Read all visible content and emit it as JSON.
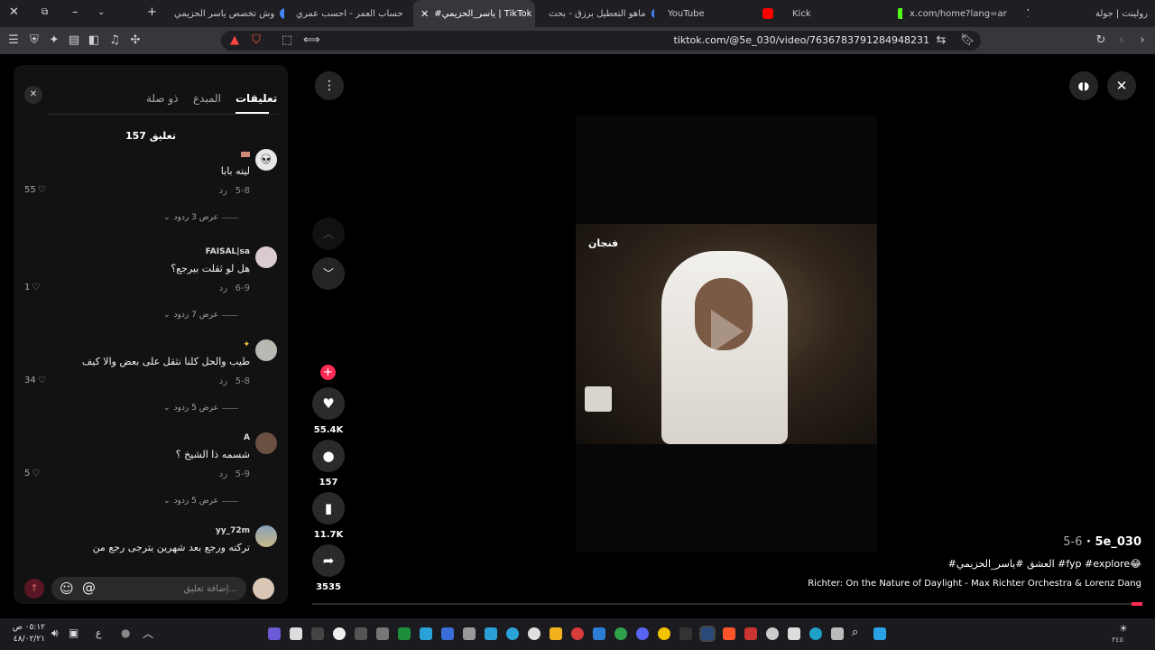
{
  "browser": {
    "tabs": [
      {
        "title": "رولينت | جولة",
        "fav_color": "#cfcfcf"
      },
      {
        "title": "x.com/home?lang=ar",
        "fav_color": "#ffffff"
      },
      {
        "title": "Kick",
        "fav_color": "#53fc18"
      },
      {
        "title": "YouTube",
        "fav_color": "#ff0000"
      },
      {
        "title": "ماهو التعطيل برزق - بحث",
        "fav_color": "#4285f4"
      },
      {
        "title": "#ياسر_الحزيمي | TikTok",
        "fav_color": "#111111"
      },
      {
        "title": "حساب العمر - احسب عمري",
        "fav_color": "#8a8a8a"
      },
      {
        "title": "وش تخصص ياسر الحزيمي",
        "fav_color": "#4285f4"
      }
    ],
    "url": "tiktok.com/@5e_030/video/7636783791284948231"
  },
  "comments_panel": {
    "tabs": {
      "comments": "تعليقات",
      "creator": "المبدع",
      "related": "ذو صلة"
    },
    "count_label": "157 تعليق",
    "reply_label": "رد",
    "comments": [
      {
        "name": "",
        "text": "ليته بابا",
        "date": "5-8",
        "likes": "55",
        "more": "عرض 3 ردود",
        "avatar_color": "#e7e7e7"
      },
      {
        "name": "FAISAL|sa",
        "text": "هل لو ثقلت بيرجع؟",
        "date": "6-9",
        "likes": "1",
        "more": "عرض 7 ردود",
        "avatar_color": "#d9cbd0"
      },
      {
        "name": "",
        "text": "طيب والحل كلنا نثقل على بعض والا كيف",
        "date": "5-8",
        "likes": "34",
        "more": "عرض 5 ردود",
        "avatar_color": "#b9b9b4"
      },
      {
        "name": "A",
        "text": "شسمه ذا الشيخ ؟",
        "date": "5-9",
        "likes": "5",
        "more": "عرض 5 ردود",
        "avatar_color": "#6a5040"
      },
      {
        "name": "yy_72m",
        "text": "تركته ورجع بعد شهرين يترجى رجع من",
        "date": "",
        "likes": "",
        "more": "",
        "avatar_color": "#8aa0b8"
      }
    ],
    "input_placeholder": "إضافة تعليق..."
  },
  "video": {
    "overlay_tag": "فنجان",
    "likes": "55.4K",
    "comments": "157",
    "saves": "11.7K",
    "shares": "3535",
    "author": "5e_030",
    "date": "5-6",
    "hashtags": "#العشق #ياسر_الحزيمي #fyp #explore😂",
    "music": "Richter: On the Nature of Daylight - Max Richter Orchestra & Lorenz Dang"
  },
  "taskbar": {
    "time": "٠٥:١٢ ص",
    "date": "٤٨/٠٢/٢١",
    "lang": "ع",
    "tray_count": "٣٤٥"
  }
}
